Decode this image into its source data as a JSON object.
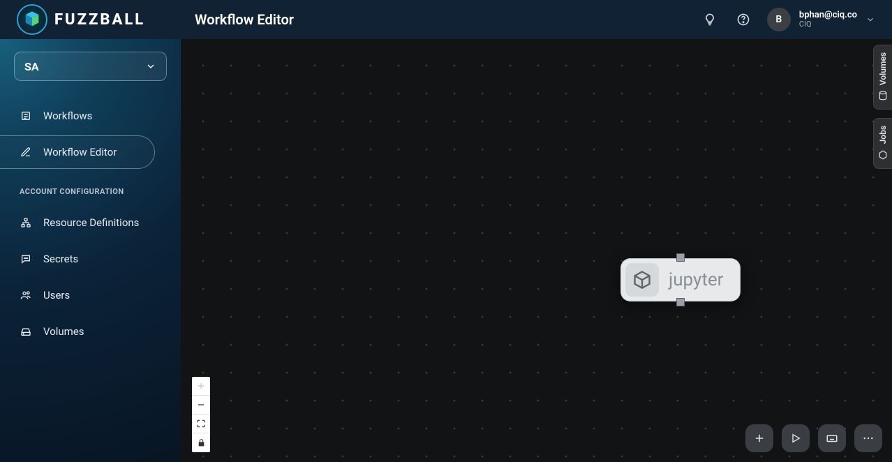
{
  "brand": {
    "name": "FUZZBALL"
  },
  "header": {
    "title": "Workflow Editor",
    "user": {
      "email": "bphan@ciq.co",
      "org": "CIQ",
      "initial": "B"
    }
  },
  "sidebar": {
    "org_selector": "SA",
    "section_label": "ACCOUNT CONFIGURATION",
    "items": [
      {
        "id": "workflows",
        "label": "Workflows",
        "icon": "list",
        "active": false
      },
      {
        "id": "workflow-editor",
        "label": "Workflow Editor",
        "icon": "edit",
        "active": true
      }
    ],
    "config_items": [
      {
        "id": "resource-definitions",
        "label": "Resource Definitions",
        "icon": "sitemap"
      },
      {
        "id": "secrets",
        "label": "Secrets",
        "icon": "chat"
      },
      {
        "id": "users",
        "label": "Users",
        "icon": "users"
      },
      {
        "id": "volumes",
        "label": "Volumes",
        "icon": "drive"
      }
    ]
  },
  "canvas": {
    "node": {
      "label": "jupyter",
      "icon": "cube"
    }
  },
  "rail": {
    "tabs": [
      {
        "id": "volumes",
        "label": "Volumes",
        "icon": "db"
      },
      {
        "id": "jobs",
        "label": "Jobs",
        "icon": "hex"
      }
    ]
  },
  "zoom_controls": [
    "plus",
    "minus",
    "fit",
    "lock"
  ],
  "actions": [
    "add",
    "run",
    "keyboard",
    "more"
  ]
}
